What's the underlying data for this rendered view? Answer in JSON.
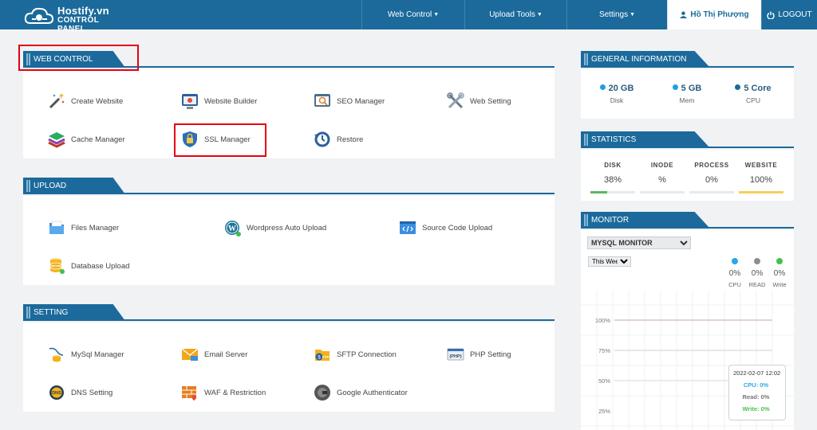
{
  "brand": {
    "name": "Hostify.vn",
    "sub": "CONTROL PANEL"
  },
  "topnav": {
    "web_control": "Web Control",
    "upload_tools": "Upload Tools",
    "settings": "Settings",
    "user": "Hồ Thị Phượng",
    "logout": "LOGOUT"
  },
  "sections": {
    "web_control": {
      "title": "WEB CONTROL",
      "items": [
        "Create Website",
        "Website Builder",
        "SEO Manager",
        "Web Setting",
        "Cache Manager",
        "SSL Manager",
        "Restore"
      ]
    },
    "upload": {
      "title": "UPLOAD",
      "items": [
        "Files Manager",
        "Wordpress Auto Upload",
        "Source Code Upload",
        "Database Upload"
      ]
    },
    "setting": {
      "title": "SETTING",
      "items": [
        "MySql Manager",
        "Email Server",
        "SFTP Connection",
        "PHP Setting",
        "DNS Setting",
        "WAF & Restriction",
        "Google Authenticator"
      ]
    }
  },
  "general": {
    "title": "GENERAL INFORMATION",
    "items": [
      {
        "value": "20 GB",
        "label": "Disk",
        "color": "#1ca0e3"
      },
      {
        "value": "5 GB",
        "label": "Mem",
        "color": "#1ca0e3"
      },
      {
        "value": "5 Core",
        "label": "CPU",
        "color": "#1b6a9b"
      }
    ]
  },
  "statistics": {
    "title": "STATISTICS",
    "items": [
      {
        "label": "DISK",
        "value": "38%",
        "level": 0.38,
        "color": "#5cb85c"
      },
      {
        "label": "INODE",
        "value": "%",
        "level": 0,
        "color": "#5cb85c"
      },
      {
        "label": "PROCESS",
        "value": "0%",
        "level": 0,
        "color": "#5cb85c"
      },
      {
        "label": "WEBSITE",
        "value": "100%",
        "level": 1.0,
        "color": "#f3cf59"
      }
    ]
  },
  "monitor": {
    "title": "MONITOR",
    "select": "MYSQL MONITOR",
    "range": "This Week",
    "legend": [
      {
        "pct": "0%",
        "name": "CPU",
        "color": "#2aa7e6"
      },
      {
        "pct": "0%",
        "name": "READ",
        "color": "#8a8f93"
      },
      {
        "pct": "0%",
        "name": "Write",
        "color": "#48c04e"
      }
    ],
    "ylabels": [
      "100%",
      "75%",
      "50%",
      "25%"
    ],
    "tooltip": {
      "date": "2022-02-07 12:02",
      "cpu": "CPU: 0%",
      "read": "Read: 0%",
      "write": "Write: 0%"
    }
  }
}
